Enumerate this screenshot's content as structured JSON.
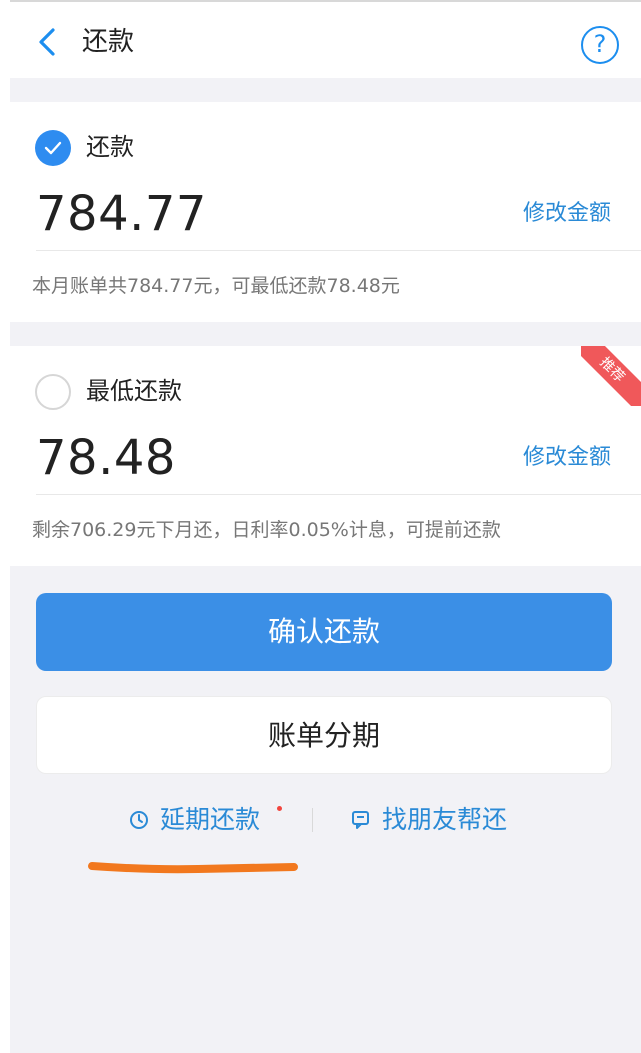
{
  "header": {
    "title": "还款",
    "help_label": "?"
  },
  "full_payment": {
    "label": "还款",
    "checked": true,
    "amount": "784.77",
    "edit_label": "修改金额",
    "note": "本月账单共784.77元，可最低还款78.48元"
  },
  "min_payment": {
    "label": "最低还款",
    "checked": false,
    "amount": "78.48",
    "edit_label": "修改金额",
    "note": "剩余706.29元下月还，日利率0.05%计息，可提前还款",
    "badge": "推荐"
  },
  "actions": {
    "confirm_label": "确认还款",
    "installment_label": "账单分期"
  },
  "links": {
    "defer_label": "延期还款",
    "friend_label": "找朋友帮还"
  },
  "colors": {
    "accent": "#2e8cf0",
    "link": "#2a8ad6",
    "badge": "#f0585a",
    "highlight": "#f2781e"
  }
}
